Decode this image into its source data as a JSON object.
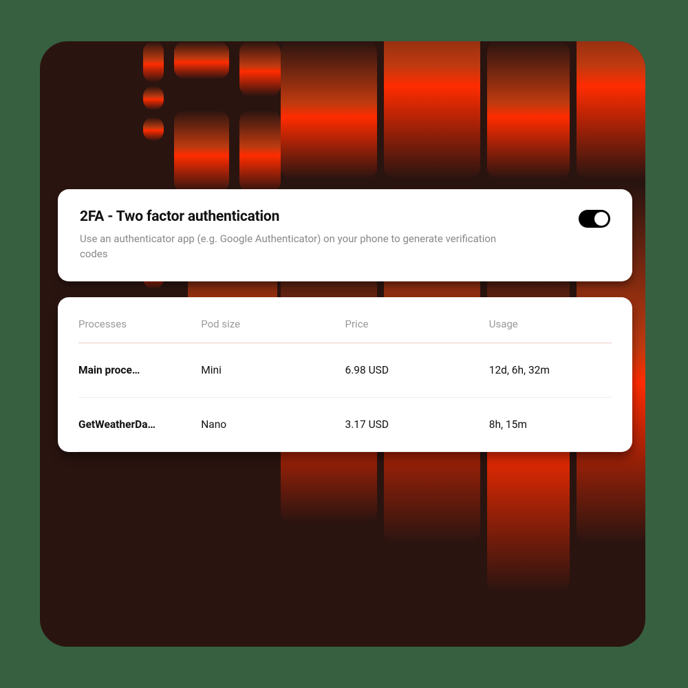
{
  "twofa": {
    "title": "2FA - Two factor authentication",
    "description": "Use an authenticator app (e.g. Google Authenticator) on your phone to generate verification codes",
    "enabled": true
  },
  "processes": {
    "columns": {
      "processes": "Processes",
      "pod_size": "Pod size",
      "price": "Price",
      "usage": "Usage"
    },
    "rows": [
      {
        "name": "Main proce…",
        "pod_size": "Mini",
        "price": "6.98 USD",
        "usage": "12d, 6h, 32m"
      },
      {
        "name": "GetWeatherDa…",
        "pod_size": "Nano",
        "price": "3.17 USD",
        "usage": "8h, 15m"
      }
    ]
  }
}
